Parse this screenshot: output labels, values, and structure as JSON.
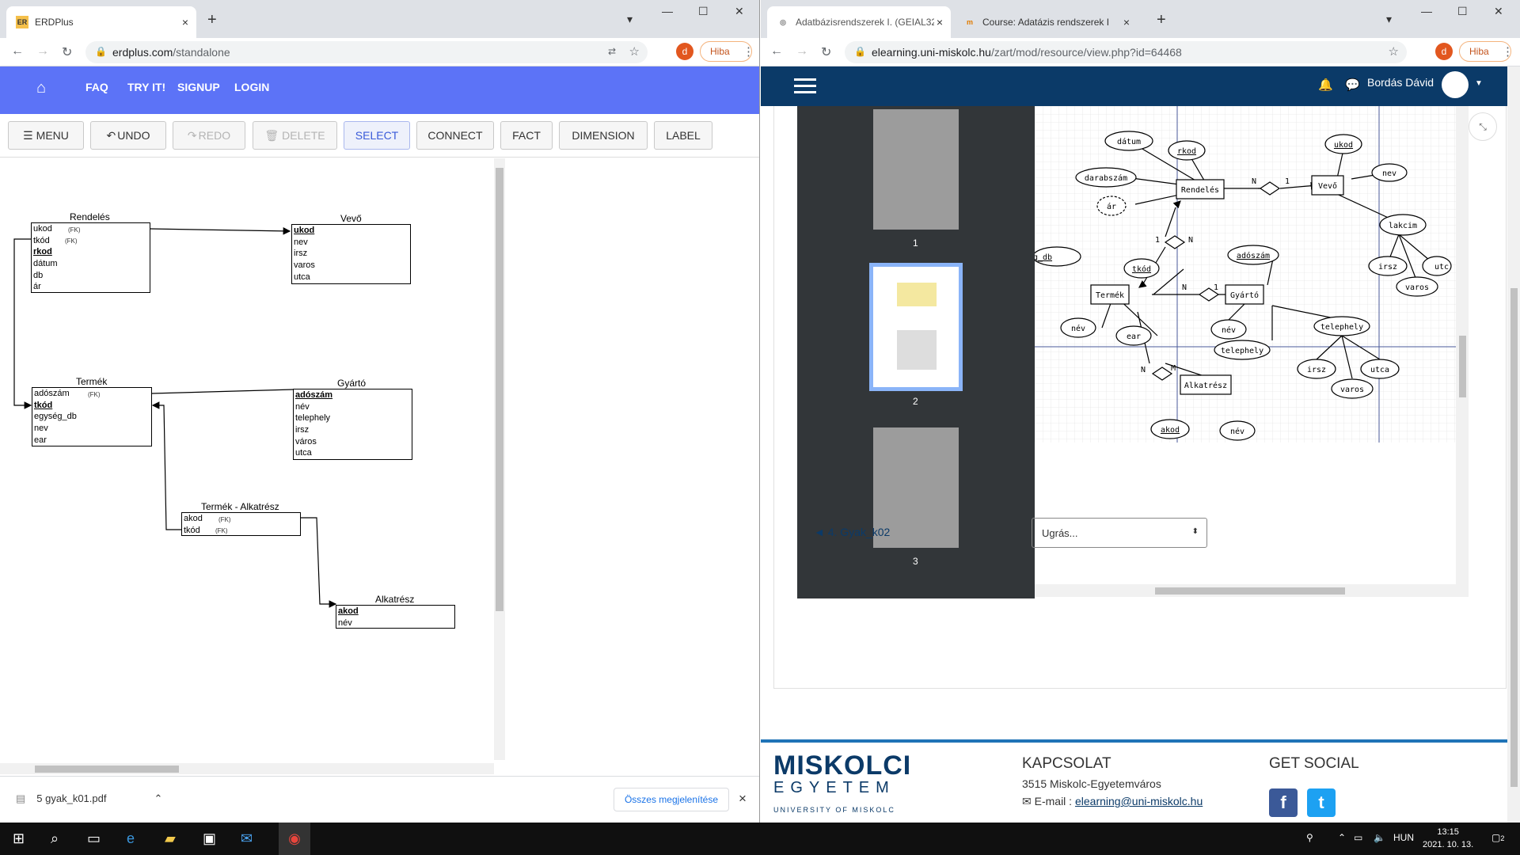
{
  "left_window": {
    "tab": {
      "favicon": "ER",
      "title": "ERDPlus",
      "close": "×"
    },
    "new_tab": "+",
    "url_host": "erdplus.com",
    "url_path": "/standalone",
    "profile_letter": "d",
    "error_chip": "Hiba",
    "erd_nav": {
      "faq": "FAQ",
      "try": "TRY IT!",
      "signup": "SIGNUP",
      "login": "LOGIN"
    },
    "erd_tools": {
      "menu": "MENU",
      "undo": "UNDO",
      "redo": "REDO",
      "delete": "DELETE",
      "select": "SELECT",
      "connect": "CONNECT",
      "fact": "FACT",
      "dimension": "DIMENSION",
      "label": "LABEL"
    },
    "tables": {
      "rendeles": {
        "title": "Rendelés",
        "rows": [
          "ukod",
          "tkód",
          "rkod",
          "dátum",
          "db",
          "ár"
        ]
      },
      "vevo": {
        "title": "Vevő",
        "rows": [
          "ukod",
          "nev",
          "irsz",
          "varos",
          "utca"
        ]
      },
      "termek": {
        "title": "Termék",
        "rows": [
          "adószám",
          "tkód",
          "egység_db",
          "nev",
          "ear"
        ]
      },
      "gyarto": {
        "title": "Gyártó",
        "rows": [
          "adószám",
          "név",
          "telephely",
          "irsz",
          "város",
          "utca"
        ]
      },
      "termek_alkatresz": {
        "title": "Termék - Alkatrész",
        "rows": [
          "akod",
          "tkód"
        ]
      },
      "alkatresz": {
        "title": "Alkatrész",
        "rows": [
          "akod",
          "név"
        ]
      }
    },
    "fk_label": "(FK)",
    "download": {
      "file": "5 gyak_k01.pdf",
      "show_all": "Összes megjelenítése",
      "close": "×"
    }
  },
  "right_window": {
    "tabs": [
      {
        "title": "Adatbázisrendszerek I. (GEIAL32",
        "close": "×"
      },
      {
        "title": "Course: Adatázis rendszerek I",
        "close": "×"
      }
    ],
    "new_tab": "+",
    "url_host": "elearning.uni-miskolc.hu",
    "url_path": "/zart/mod/resource/view.php?id=64468",
    "profile_letter": "d",
    "error_chip": "Hiba",
    "user_name": "Bordás Dávid",
    "pdf_pages": [
      "1",
      "2",
      "3"
    ],
    "erd_diagram": {
      "entities": [
        "Rendelés",
        "Vevő",
        "Termék",
        "Gyártó",
        "Alkatrész"
      ],
      "attributes": [
        "dátum",
        "rkod",
        "ukod",
        "nev",
        "darabszám",
        "ár",
        "lakcim",
        "irsz",
        "utc",
        "varos",
        "g_db",
        "tkód",
        "adószám",
        "név",
        "ear",
        "név",
        "telephely",
        "telephely",
        "irsz",
        "utca",
        "varos",
        "akod",
        "név"
      ],
      "cardinalities": [
        "N",
        "1",
        "1",
        "N",
        "N",
        "1",
        "N",
        "M"
      ]
    },
    "prev_link": "◄ 4. Gyak_k02",
    "jump_select": "Ugrás...",
    "footer": {
      "logo_top": "MISKOLCI",
      "logo_mid": "EGYETEM",
      "logo_bottom": "UNIVERSITY OF MISKOLC",
      "contact_heading": "KAPCSOLAT",
      "address": "3515 Miskolc-Egyetemváros",
      "email_label": "E-mail :",
      "email": "elearning@uni-miskolc.hu",
      "social_heading": "GET SOCIAL"
    }
  },
  "taskbar": {
    "lang": "HUN",
    "time": "13:15",
    "date": "2021. 10. 13.",
    "notif_count": "2"
  }
}
